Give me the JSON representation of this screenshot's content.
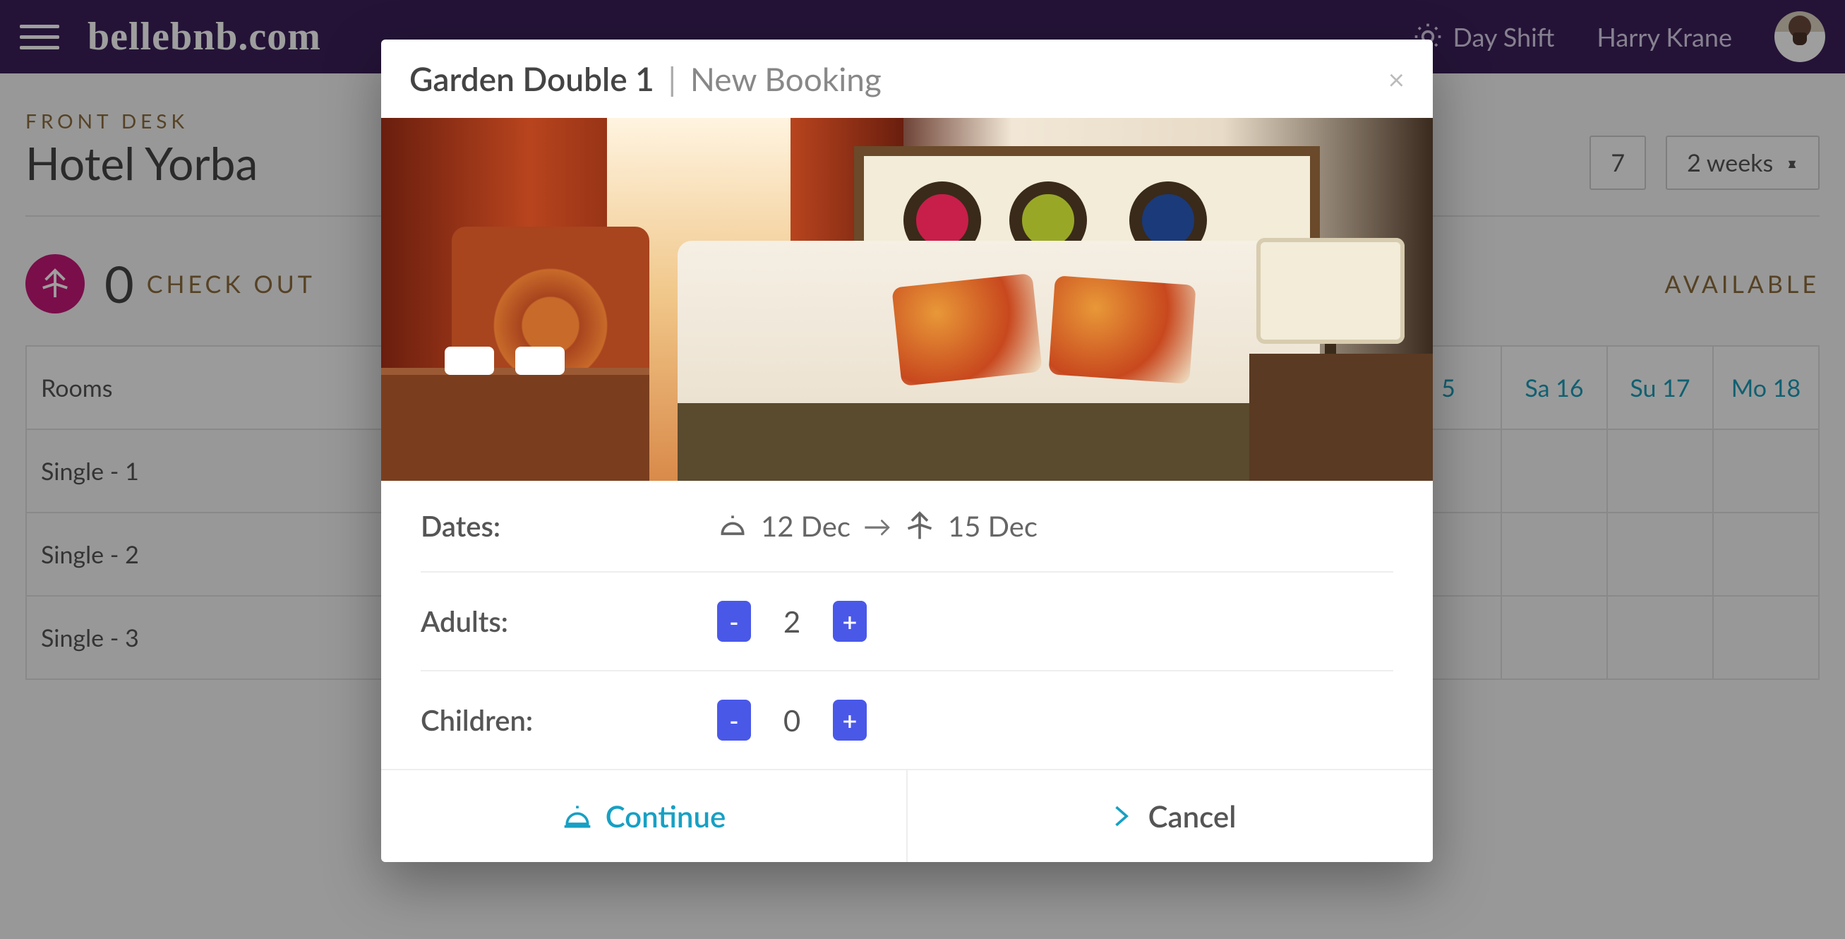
{
  "header": {
    "brand": "bellebnb.com",
    "shift_label": "Day Shift",
    "user_name": "Harry Krane"
  },
  "page": {
    "crumb": "FRONT DESK",
    "title": "Hotel Yorba",
    "date_control": "7",
    "range_control": "2 weeks"
  },
  "stats": {
    "checkouts_count": "0",
    "checkouts_label": "CHECK OUT",
    "available_label": "AVAILABLE"
  },
  "calendar": {
    "rooms_header": "Rooms",
    "days": [
      "5",
      "Sa 16",
      "Su 17",
      "Mo 18"
    ],
    "rooms": [
      "Single - 1",
      "Single - 2",
      "Single - 3"
    ]
  },
  "modal": {
    "room_name": "Garden Double 1",
    "subtitle": "New Booking",
    "dates_label": "Dates:",
    "checkin": "12 Dec",
    "checkout": "15 Dec",
    "adults_label": "Adults:",
    "adults_value": "2",
    "children_label": "Children:",
    "children_value": "0",
    "continue_label": "Continue",
    "cancel_label": "Cancel"
  },
  "icons": {
    "minus": "-",
    "plus": "+",
    "arrow": "→",
    "close": "×"
  }
}
